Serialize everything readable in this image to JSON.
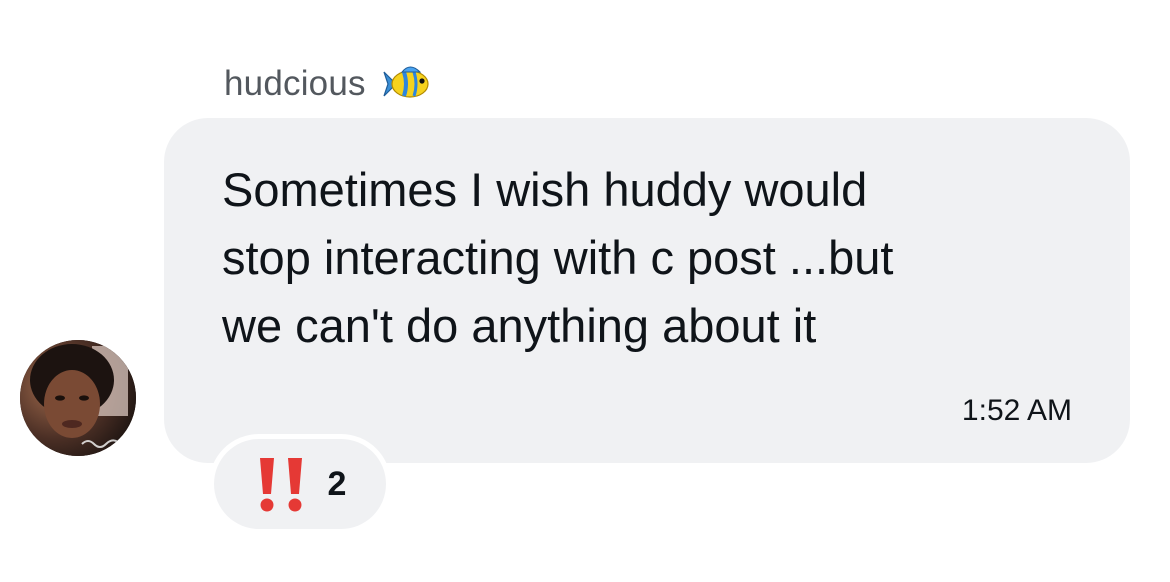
{
  "message": {
    "sender_name": "hudcious",
    "sender_badge_icon": "tropical-fish-emoji",
    "text": "Sometimes I wish huddy would\nstop interacting with c post ...but\nwe can't do anything about it",
    "timestamp": "1:52 AM",
    "reaction": {
      "emoji": "double-exclamation-emoji",
      "count": "2"
    }
  },
  "colors": {
    "bubble_background": "#f0f1f3",
    "text": "#0f1419",
    "sender_name": "#53585e",
    "reaction_emoji": "#e53935"
  }
}
